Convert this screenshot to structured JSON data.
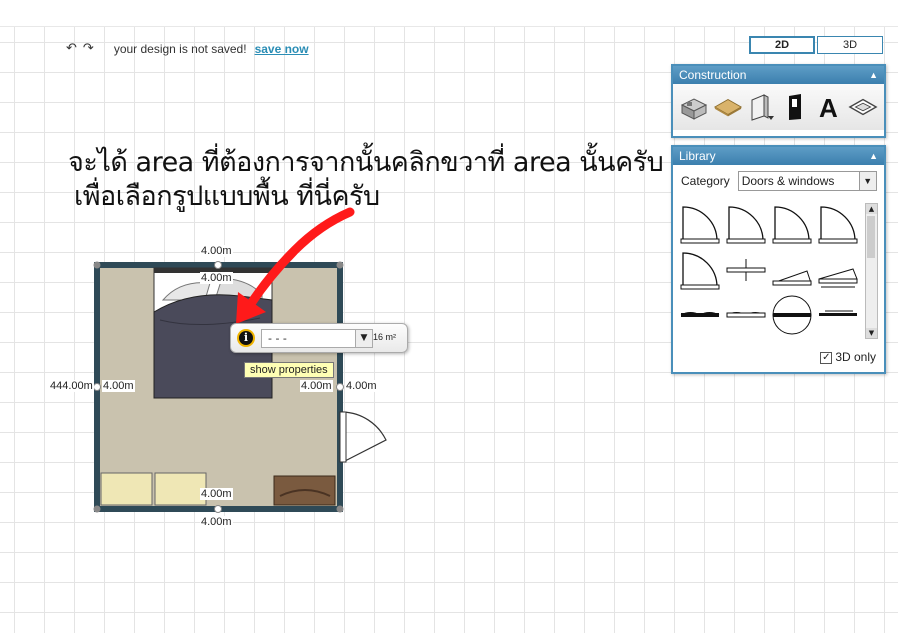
{
  "toolbar": {
    "undo_icon": "undo-icon",
    "redo_icon": "redo-icon",
    "status_message": "your design is not saved!",
    "save_link": "save now"
  },
  "view_toggle": {
    "option_2d": "2D",
    "option_3d": "3D",
    "active": "2D"
  },
  "construction_panel": {
    "title": "Construction",
    "tools": [
      "room-icon",
      "floor-icon",
      "wall-icon",
      "door-icon",
      "text-icon",
      "surface-icon"
    ]
  },
  "library_panel": {
    "title": "Library",
    "category_label": "Category",
    "category_value": "Doors & windows",
    "show_3d_label": "3D only",
    "show_3d_checked": true
  },
  "annotation": {
    "line1": "จะได้ area ที่ต้องการจากนั้นคลิกขวาที่ area นั้นครับ",
    "line2": "เพื่อเลือกรูปแบบพื้น ที่นี่ครับ",
    "arrow_color": "#ff1a1a"
  },
  "room_popup": {
    "info_icon": "info-icon",
    "floor_select_value": "- - -",
    "area_text": "16 m²",
    "tooltip": "show properties"
  },
  "dimensions": {
    "top_outer": "4.00m",
    "top_inner": "4.00m",
    "left_outer": "4.00m",
    "left_inner": "4.00m",
    "left_prefix": "44",
    "right_inner": "4.00m",
    "right_outer": "4.00m",
    "bottom_inner": "4.00m",
    "bottom_outer": "4.00m"
  },
  "colors": {
    "accent": "#3b7fae",
    "wall": "#2f4a57",
    "floor": "#c9c2ae",
    "save_link": "#2a8db5",
    "tooltip_bg": "#ffffb4"
  }
}
